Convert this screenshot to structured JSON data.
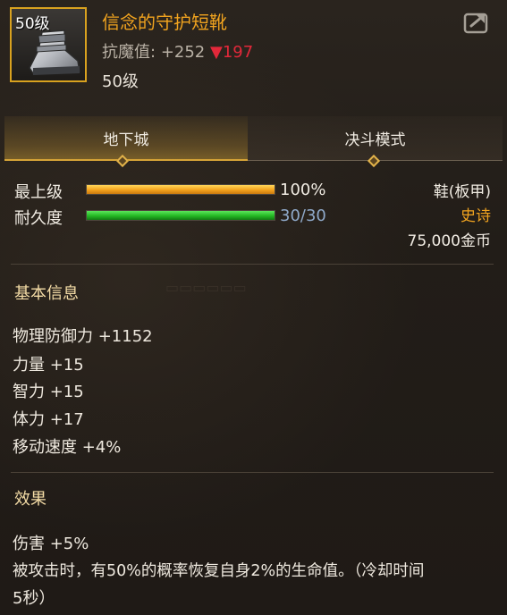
{
  "item": {
    "level_badge": "50级",
    "name": "信念的守护短靴",
    "stat_label": "抗魔值:",
    "stat_value": "+252",
    "stat_delta": "▼197",
    "required_level": "50级"
  },
  "tabs": [
    {
      "label": "地下城",
      "active": true
    },
    {
      "label": "决斗模式",
      "active": false
    }
  ],
  "bars": [
    {
      "label": "最上级",
      "value_text": "100%",
      "fraction": 1.0,
      "color": "#f3a21c",
      "value_color": "#f1ece3"
    },
    {
      "label": "耐久度",
      "value_text": "30/30",
      "fraction": 1.0,
      "color": "#23b823",
      "value_color": "#8fa9c9"
    }
  ],
  "info": {
    "type": "鞋(板甲)",
    "rarity": "史诗",
    "rarity_color": "#f0a31f",
    "price": "75,000金币"
  },
  "basic_info": {
    "title": "基本信息",
    "attributes": [
      "物理防御力 +1152",
      "力量 +15",
      "智力 +15",
      "体力 +17",
      "移动速度 +4%"
    ]
  },
  "effects": {
    "title": "效果",
    "lines": [
      "伤害 +5%",
      "被攻击时，有50%的概率恢复自身2%的生命值。（冷却时间",
      "5秒）"
    ]
  },
  "icons": {
    "share": "share-icon",
    "item": "boot-icon",
    "tab_marker": "diamond-icon"
  },
  "colors": {
    "accent": "#d9a21f",
    "item_name": "#f0a31f",
    "delta": "#e2283a"
  }
}
